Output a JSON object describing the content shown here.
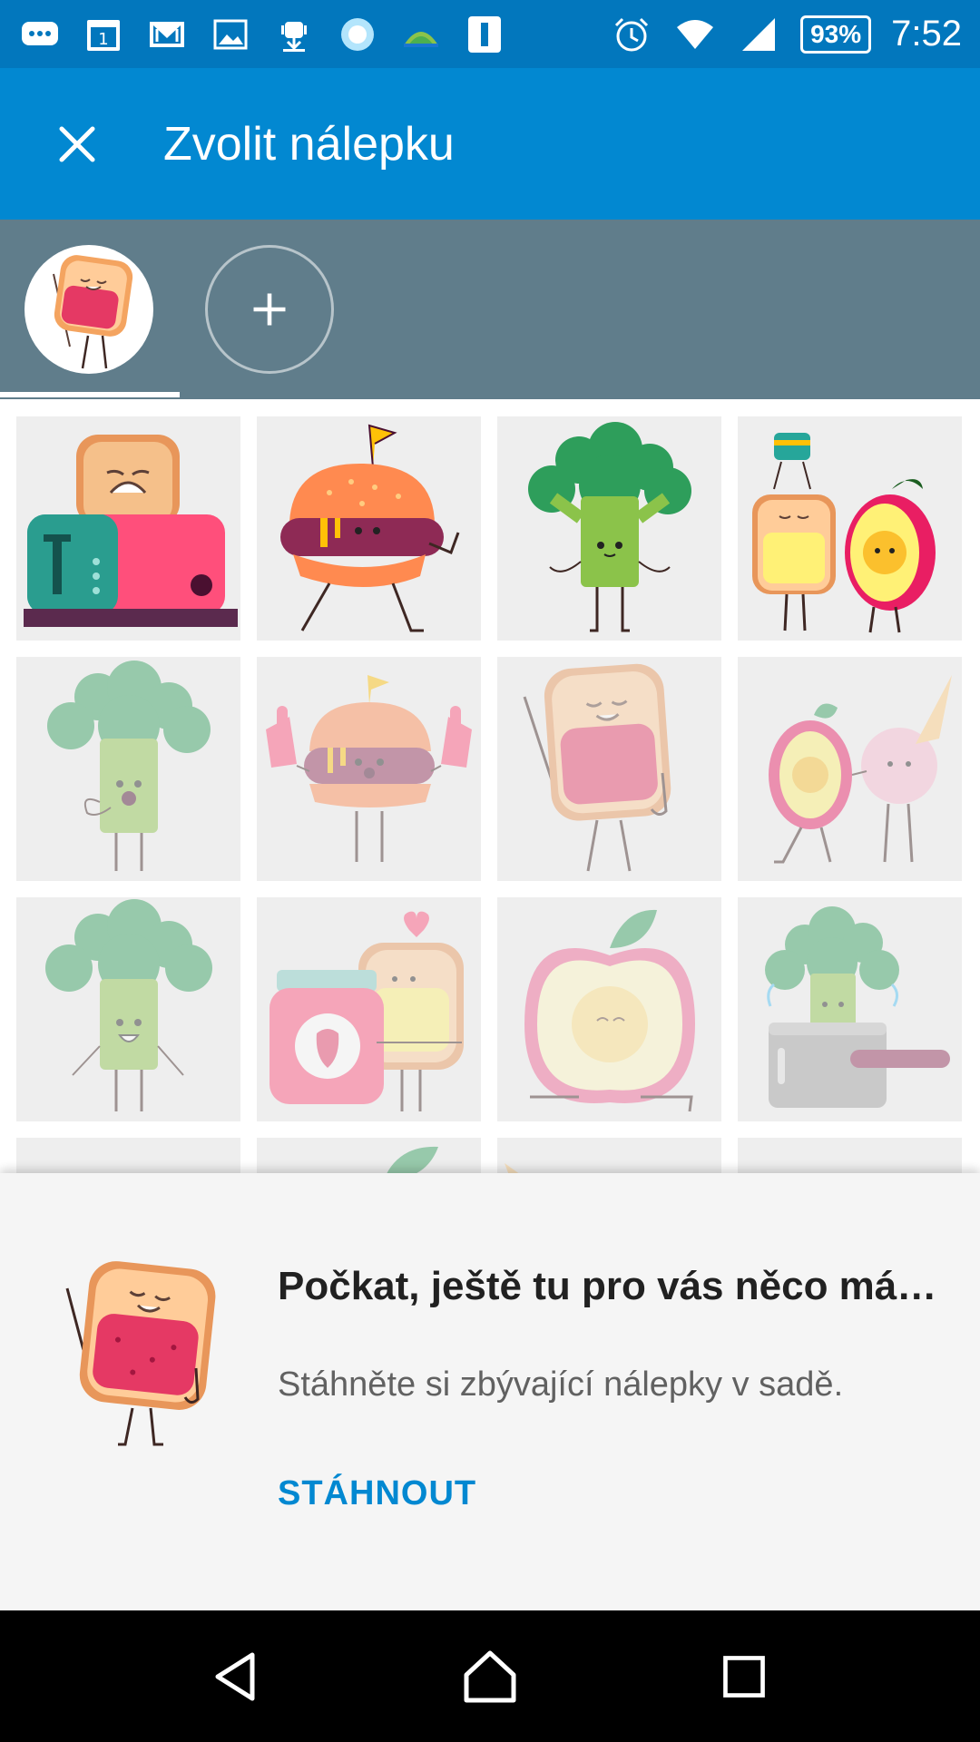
{
  "status_bar": {
    "battery": "93%",
    "time": "7:52",
    "left_icons": [
      "chat-icon",
      "calendar-icon",
      "gmail-icon",
      "image-icon",
      "android-download-icon",
      "record-icon",
      "app-icon",
      "info-icon"
    ],
    "right_icons": [
      "alarm-icon",
      "wifi-icon",
      "signal-icon"
    ]
  },
  "app_bar": {
    "title": "Zvolit nálepku",
    "close_icon": "close-icon"
  },
  "pack_tabs": {
    "items": [
      {
        "name": "toast-pack",
        "active": true
      },
      {
        "name": "add-pack",
        "icon": "plus-icon"
      }
    ]
  },
  "stickers": [
    {
      "name": "toaster-sticker",
      "faded": false
    },
    {
      "name": "burger-walking-sticker",
      "faded": false
    },
    {
      "name": "broccoli-sticker",
      "faded": false
    },
    {
      "name": "toast-apple-sticker",
      "faded": false
    },
    {
      "name": "broccoli-surprised-sticker",
      "faded": true
    },
    {
      "name": "burger-fans-sticker",
      "faded": true
    },
    {
      "name": "toast-jam-sticker",
      "faded": true
    },
    {
      "name": "apple-icecream-sticker",
      "faded": true
    },
    {
      "name": "broccoli-happy-sticker",
      "faded": true
    },
    {
      "name": "jam-toast-sticker",
      "faded": true
    },
    {
      "name": "apple-half-sticker",
      "faded": true
    },
    {
      "name": "broccoli-pot-sticker",
      "faded": true
    }
  ],
  "sheet": {
    "title": "Počkat, ještě tu pro vás něco má…",
    "subtitle": "Stáhněte si zbývající nálepky v sadě.",
    "action": "STÁHNOUT"
  },
  "nav_bar": {
    "icons": [
      "back-icon",
      "home-icon",
      "recents-icon"
    ]
  },
  "colors": {
    "status_bar": "#0277bd",
    "app_bar": "#0288d1",
    "pack_bar": "#607d8b",
    "accent": "#0288d1"
  }
}
